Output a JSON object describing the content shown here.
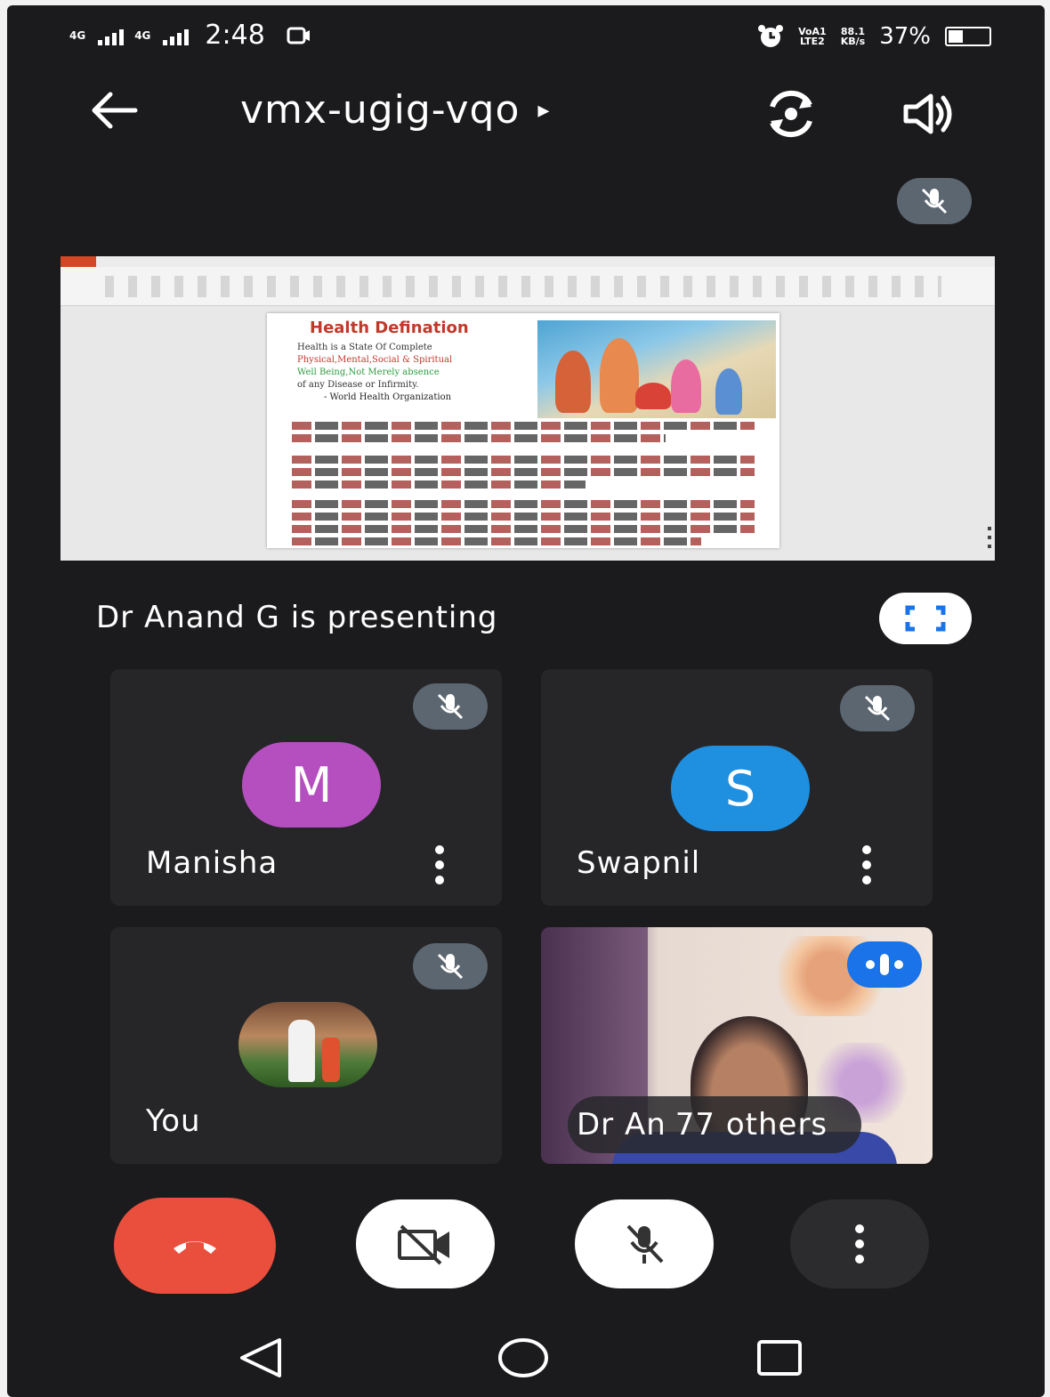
{
  "status_bar": {
    "network_1": "4G",
    "network_2": "4G",
    "time": "2:48",
    "volte_line1": "VoA1",
    "volte_line2": "LTE2",
    "speed_line1": "88.1",
    "speed_line2": "KB/s",
    "battery": "37%",
    "battery_level": 0.37
  },
  "top_bar": {
    "meeting_code": "vmx-ugig-vqo",
    "arrow": "▸"
  },
  "presentation": {
    "slide_title": "Health Defination",
    "slide_lines": [
      "Health is a State Of Complete",
      "Physical,Mental,Social & Spiritual",
      "Well Being,Not Merely absence",
      "of any Disease or Infirmity.",
      "- World Health Organization"
    ],
    "presenting_label": "Dr Anand G is presenting"
  },
  "participants": {
    "manisha": {
      "name": "Manisha",
      "initial": "M",
      "color": "#b54fbf"
    },
    "swapnil": {
      "name": "Swapnil",
      "initial": "S",
      "color": "#1f8fe0"
    },
    "you": {
      "name": "You"
    },
    "others": {
      "name": "Dr An",
      "overlay": "77 others"
    }
  },
  "icons": {
    "back": "arrow-left-icon",
    "switch_camera": "switch-camera-icon",
    "speaker": "speaker-icon",
    "mic_off": "mic-off-icon",
    "fullscreen": "fullscreen-icon",
    "end_call": "end-call-icon",
    "camera_off": "camera-off-icon",
    "more": "more-vert-icon"
  }
}
